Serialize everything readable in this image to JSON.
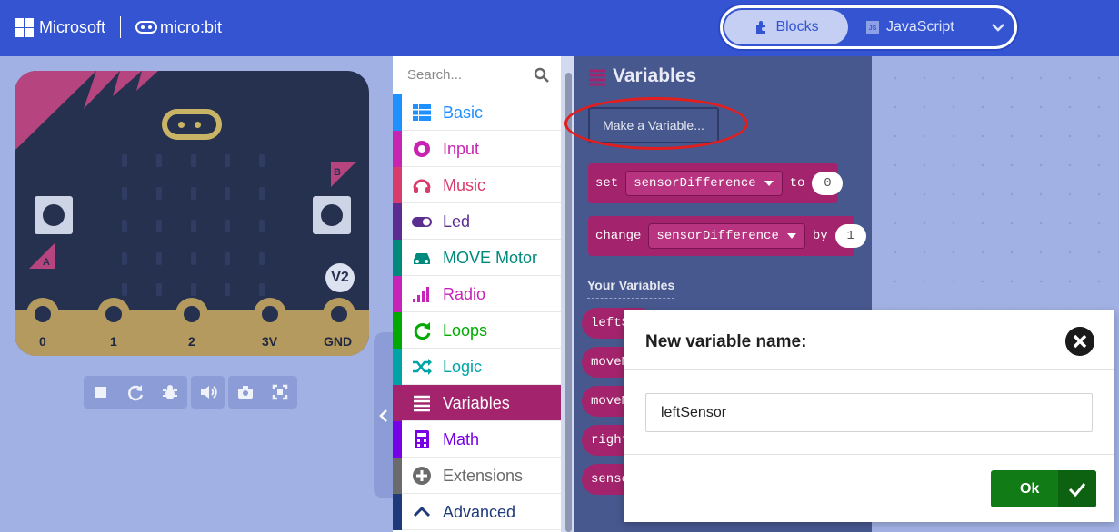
{
  "header": {
    "brand": "Microsoft",
    "product": "micro:bit",
    "tabs": {
      "blocks": "Blocks",
      "javascript": "JavaScript",
      "js_badge": "JS"
    }
  },
  "simulator": {
    "pins": [
      "0",
      "1",
      "2",
      "3V",
      "GND"
    ],
    "button_a": "A",
    "button_b": "B",
    "version": "V2",
    "controls": [
      "stop-icon",
      "restart-icon",
      "debug-icon",
      "sound-icon",
      "screenshot-icon",
      "fullscreen-icon"
    ]
  },
  "toolbox": {
    "search_placeholder": "Search...",
    "categories": [
      {
        "label": "Basic",
        "color": "#1e90ff"
      },
      {
        "label": "Input",
        "color": "#c724b1"
      },
      {
        "label": "Music",
        "color": "#d83b6c"
      },
      {
        "label": "Led",
        "color": "#5c2d91"
      },
      {
        "label": "MOVE Motor",
        "color": "#008a7c"
      },
      {
        "label": "Radio",
        "color": "#c624b8"
      },
      {
        "label": "Loops",
        "color": "#00aa00"
      },
      {
        "label": "Logic",
        "color": "#00a4a6"
      },
      {
        "label": "Variables",
        "color": "#a3246d"
      },
      {
        "label": "Math",
        "color": "#7600e6"
      },
      {
        "label": "Extensions",
        "color": "#6b6b6b"
      },
      {
        "label": "Advanced",
        "color": "#1f3a7a"
      }
    ]
  },
  "flyout": {
    "title": "Variables",
    "make_variable": "Make a Variable...",
    "set_block": {
      "kw": "set",
      "var": "sensorDifference",
      "to": "to",
      "value": "0"
    },
    "change_block": {
      "kw": "change",
      "var": "sensorDifference",
      "by": "by",
      "value": "1"
    },
    "your_variables": "Your Variables",
    "variables": [
      "leftS",
      "moveM",
      "moveM",
      "right",
      "senso"
    ]
  },
  "dialog": {
    "title": "New variable name:",
    "input_value": "leftSensor",
    "ok": "Ok"
  }
}
